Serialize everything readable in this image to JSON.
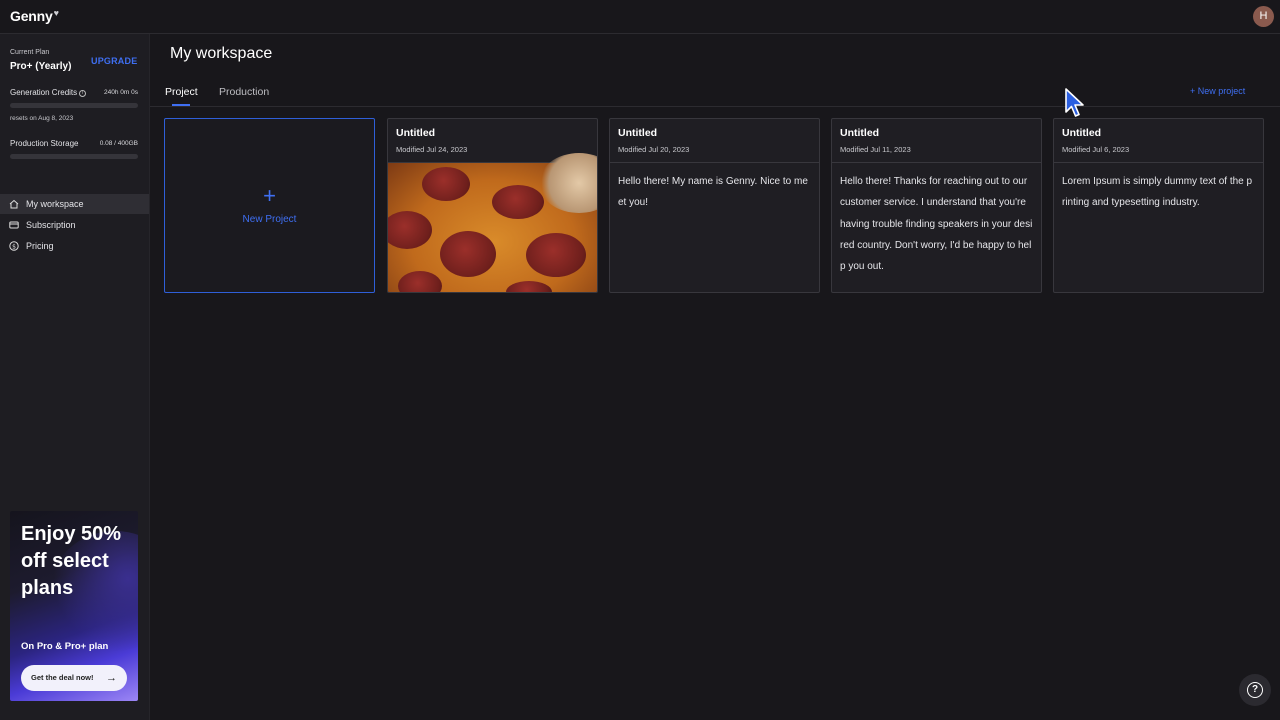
{
  "app": {
    "logo": "Genny",
    "logo_mark": "♥",
    "avatar_initial": "H"
  },
  "sidebar": {
    "plan_label": "Current Plan",
    "plan_name": "Pro+ (Yearly)",
    "upgrade_label": "UPGRADE",
    "credits_label": "Generation Credits",
    "credits_value": "240h 0m 0s",
    "credits_reset": "resets on Aug 8, 2023",
    "storage_label": "Production Storage",
    "storage_value": "0.08 / 400GB",
    "nav": [
      {
        "label": "My workspace",
        "icon": "home-icon",
        "active": true
      },
      {
        "label": "Subscription",
        "icon": "card-icon",
        "active": false
      },
      {
        "label": "Pricing",
        "icon": "dollar-icon",
        "active": false
      }
    ],
    "promo": {
      "title": "Enjoy 50% off select plans",
      "subtitle": "On Pro & Pro+ plan",
      "button": "Get the deal now!"
    }
  },
  "main": {
    "title": "My workspace",
    "tabs": [
      {
        "label": "Project",
        "active": true
      },
      {
        "label": "Production",
        "active": false
      }
    ],
    "new_project_link": "New project",
    "new_project_card": "New Project",
    "cards": [
      {
        "title": "Untitled",
        "modified": "Modified Jul 24, 2023",
        "type": "image",
        "image": "pepperoni-pizza"
      },
      {
        "title": "Untitled",
        "modified": "Modified Jul 20, 2023",
        "type": "text",
        "body": "Hello there! My name is Genny. Nice to meet you!"
      },
      {
        "title": "Untitled",
        "modified": "Modified Jul 11, 2023",
        "type": "text",
        "body": "Hello there! Thanks for reaching out to our customer service. I understand that you're having trouble finding speakers in your desired country. Don't worry, I'd be happy to help you out."
      },
      {
        "title": "Untitled",
        "modified": "Modified Jul 6, 2023",
        "type": "text",
        "body": "Lorem Ipsum is simply dummy text of the printing and typesetting industry."
      }
    ]
  },
  "help_label": "?",
  "colors": {
    "accent": "#3f6ff2",
    "background": "#18171b",
    "sidebar": "#1e1d22"
  }
}
